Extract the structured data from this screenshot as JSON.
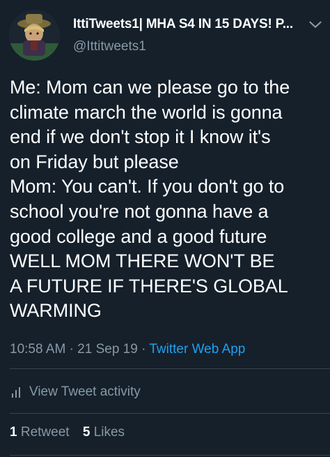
{
  "tweet": {
    "display_name": "IttiTweets1| MHA S4 IN 15 DAYS! P...",
    "handle": "@Ittitweets1",
    "text_lines": [
      "Me: Mom can we please go to the",
      "climate march the world is gonna",
      "end if we don't stop it I know it's",
      "on Friday but please",
      "Mom: You can't. If you don't go to",
      "school you're not gonna have a",
      "good college and a good future",
      "WELL MOM THERE WON'T BE",
      "A FUTURE IF THERE'S GLOBAL",
      "WARMING"
    ],
    "time": "10:58 AM",
    "date": "21 Sep 19",
    "separator": "·",
    "source": "Twitter Web App"
  },
  "activity": {
    "label": "View Tweet activity",
    "icon": "bar-chart-icon"
  },
  "stats": {
    "retweets_count": "1",
    "retweets_label": "Retweet",
    "likes_count": "5",
    "likes_label": "Likes"
  },
  "colors": {
    "background": "#15202b",
    "text": "#ffffff",
    "secondary": "#8899a6",
    "link": "#1da1f2",
    "divider": "#38444d"
  }
}
